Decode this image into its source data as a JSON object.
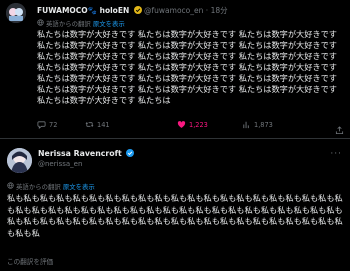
{
  "post1": {
    "author_name": "FUWAMOCO🐾 holoEN",
    "handle": "@fuwamoco_en",
    "separator": "·",
    "time": "18分",
    "translated_label": "英語からの翻訳",
    "show_original": "原文を表示",
    "text": "私たちは数字が大好きです 私たちは数字が大好きです 私たちは数字が大好きです 私たちは数字が大好きです 私たちは数字が大好きです 私たちは数字が大好きです 私たちは数字が大好きです 私たちは数字が大好きです 私たちは数字が大好きです 私たちは数字が大好きです 私たちは数字が大好きです 私たちは数字が大好きです 私たちは数字が大好きです 私たちは数字が大好きです 私たちは数字が大好きです 私たちは数字が大好きです 私たちは数字が大好きです 私たちは数字が大好きです 私たちは数字が大好きです 私たちは",
    "replies": "72",
    "reposts": "141",
    "likes": "1,223",
    "views": "1,873"
  },
  "post2": {
    "author_name": "Nerissa Ravencroft",
    "handle": "@nerissa_en",
    "translated_label": "英語からの翻訳",
    "show_original": "原文を表示",
    "text": "私も私も私も私も私も私も私も私も私も私も私も私も私も私も私も私も私も私も私も私も私も私も私も私も私も私も私も私も私も私も私も私も私も私も私も私も私も私も私も私も私も私も私も私も私も私も私も私も私も私も私も私も私も私も私も私も私も私も私も私も私も私も私も私",
    "rate_translation": "この翻訳を評価"
  },
  "colors": {
    "background": "#000000",
    "text": "#e7e9ea",
    "muted": "#71767b",
    "link": "#1d9bf0",
    "like": "#f91880",
    "verified_gold": "#e2b719",
    "verified_blue": "#1d9bf0"
  },
  "icons": [
    "reply-icon",
    "repost-icon",
    "heart-icon",
    "views-icon",
    "share-icon",
    "verified-badge-icon",
    "globe-icon"
  ]
}
